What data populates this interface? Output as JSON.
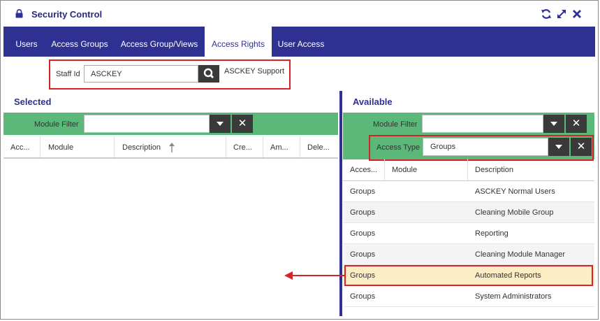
{
  "window": {
    "title": "Security Control"
  },
  "tabs": [
    {
      "label": "Users"
    },
    {
      "label": "Access Groups"
    },
    {
      "label": "Access Group/Views"
    },
    {
      "label": "Access Rights"
    },
    {
      "label": "User Access"
    }
  ],
  "staff": {
    "label": "Staff Id",
    "value": "ASCKEY",
    "name": "ASCKEY  Support"
  },
  "selected": {
    "title": "Selected",
    "module_filter_label": "Module Filter",
    "module_filter_value": "",
    "columns": [
      "Acc...",
      "Module",
      "Description",
      "Cre...",
      "Am...",
      "Dele..."
    ]
  },
  "available": {
    "title": "Available",
    "module_filter_label": "Module Filter",
    "module_filter_value": "",
    "access_type_label": "Access Type",
    "access_type_value": "Groups",
    "columns": [
      "Acces...",
      "Module",
      "Description"
    ],
    "rows": [
      {
        "access": "Groups",
        "module": "",
        "description": "ASCKEY Normal Users"
      },
      {
        "access": "Groups",
        "module": "",
        "description": "Cleaning Mobile Group"
      },
      {
        "access": "Groups",
        "module": "",
        "description": "Reporting"
      },
      {
        "access": "Groups",
        "module": "",
        "description": "Cleaning Module Manager"
      },
      {
        "access": "Groups",
        "module": "",
        "description": "Automated Reports"
      },
      {
        "access": "Groups",
        "module": "",
        "description": "System Administrators"
      }
    ]
  },
  "colors": {
    "accent": "#2e3192",
    "filter_bar": "#5cb878",
    "highlight": "#fdedc4",
    "annotation": "#d8222a"
  }
}
